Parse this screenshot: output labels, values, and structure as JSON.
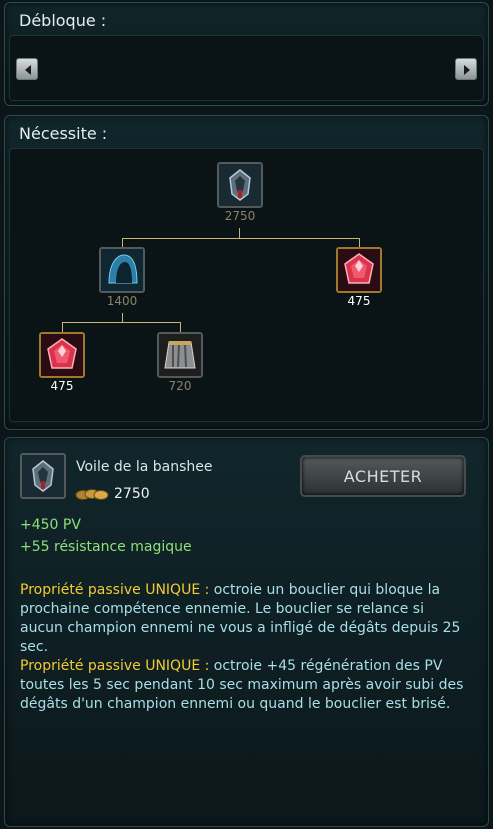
{
  "unlocks": {
    "title": "Débloque :",
    "prev_icon": "arrow-left-icon",
    "next_icon": "arrow-right-icon"
  },
  "requires": {
    "title": "Nécessite :",
    "root": {
      "icon": "banshee-veil-icon",
      "cost": "2750",
      "affordable": false
    },
    "children": [
      {
        "icon": "spectre-cowl-icon",
        "cost": "1400",
        "affordable": false,
        "children": [
          {
            "icon": "ruby-crystal-icon",
            "cost": "475",
            "affordable": true
          },
          {
            "icon": "null-magic-mantle-icon",
            "cost": "720",
            "affordable": false
          }
        ]
      },
      {
        "icon": "ruby-crystal-icon",
        "cost": "475",
        "affordable": true
      }
    ]
  },
  "details": {
    "icon": "banshee-veil-icon",
    "name": "Voile de la banshee",
    "gold_icon": "gold-coins-icon",
    "cost": "2750",
    "buy_label": "ACHETER",
    "stats": [
      "+450 PV",
      "+55 résistance magique"
    ],
    "passives": [
      {
        "label": "Propriété passive UNIQUE :",
        "lines": [
          "octroie un bouclier qui bloque la",
          "prochaine compétence ennemie. Le bouclier se relance si",
          "aucun champion ennemi ne vous a infligé de dégâts depuis 25",
          "sec."
        ]
      },
      {
        "label": "Propriété passive UNIQUE :",
        "lines": [
          "octroie +45 régénération des PV",
          "toutes les 5 sec pendant 10 sec maximum après avoir subi des",
          "dégâts d'un champion ennemi ou quand le bouclier est brisé."
        ]
      }
    ]
  },
  "colors": {
    "stat_green": "#8fe07a",
    "passive_yellow": "#f2cc34",
    "passive_text": "#a9dfe6",
    "gold_frame": "#a07a2c"
  }
}
